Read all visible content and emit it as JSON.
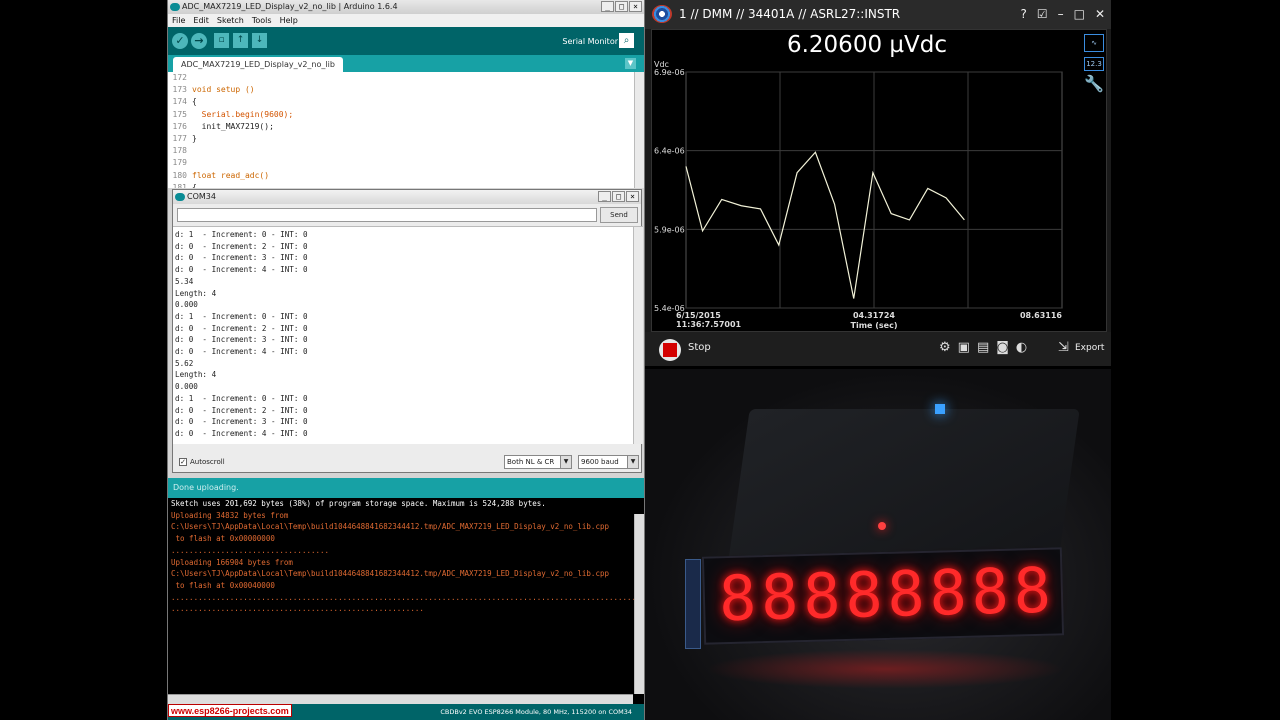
{
  "arduino": {
    "title": "ADC_MAX7219_LED_Display_v2_no_lib | Arduino 1.6.4",
    "menu": [
      "File",
      "Edit",
      "Sketch",
      "Tools",
      "Help"
    ],
    "serial_monitor_label": "Serial Monitor",
    "tab_label": "ADC_MAX7219_LED_Display_v2_no_lib",
    "code_lines": [
      {
        "n": "172",
        "code": ""
      },
      {
        "n": "173",
        "code": "void setup ()"
      },
      {
        "n": "174",
        "code": "{"
      },
      {
        "n": "175",
        "code": "  Serial.begin(9600);"
      },
      {
        "n": "176",
        "code": "  init_MAX7219();"
      },
      {
        "n": "177",
        "code": "}"
      },
      {
        "n": "178",
        "code": ""
      },
      {
        "n": "179",
        "code": ""
      },
      {
        "n": "180",
        "code": "float read_adc()"
      },
      {
        "n": "181",
        "code": "{"
      }
    ],
    "status": "Done uploading.",
    "console_lines": [
      {
        "text": "",
        "color": "white"
      },
      {
        "text": "Sketch uses 201,692 bytes (38%) of program storage space. Maximum is 524,288 bytes.",
        "color": "white"
      },
      {
        "text": "Uploading 34832 bytes from",
        "color": "orange"
      },
      {
        "text": "C:\\Users\\TJ\\AppData\\Local\\Temp\\build1044648841682344412.tmp/ADC_MAX7219_LED_Display_v2_no_lib.cpp",
        "color": "orange"
      },
      {
        "text": " to flash at 0x00000000",
        "color": "orange"
      },
      {
        "text": "",
        "color": "orange"
      },
      {
        "text": "...................................",
        "color": "orange"
      },
      {
        "text": "",
        "color": "orange"
      },
      {
        "text": "Uploading 166904 bytes from",
        "color": "orange"
      },
      {
        "text": "C:\\Users\\TJ\\AppData\\Local\\Temp\\build1044648841682344412.tmp/ADC_MAX7219_LED_Display_v2_no_lib.cpp",
        "color": "orange"
      },
      {
        "text": " to flash at 0x00040000",
        "color": "orange"
      },
      {
        "text": "",
        "color": "orange"
      },
      {
        "text": "...........................................................................................................................",
        "color": "orange"
      },
      {
        "text": "........................................................",
        "color": "orange"
      }
    ],
    "footer_message": "CBDBv2 EVO ESP8266 Module, 80 MHz, 115200 on COM34",
    "watermark": "www.esp8266-projects.com"
  },
  "com": {
    "title": "COM34",
    "send_label": "Send",
    "lines": [
      "d: 1  - Increment: 0 - INT: 0",
      "d: 0  - Increment: 2 - INT: 0",
      "d: 0  - Increment: 3 - INT: 0",
      "d: 0  - Increment: 4 - INT: 0",
      "5.34",
      "Length: 4",
      "0.000",
      "d: 1  - Increment: 0 - INT: 0",
      "d: 0  - Increment: 2 - INT: 0",
      "d: 0  - Increment: 3 - INT: 0",
      "d: 0  - Increment: 4 - INT: 0",
      "5.62",
      "Length: 4",
      "0.000",
      "d: 1  - Increment: 0 - INT: 0",
      "d: 0  - Increment: 2 - INT: 0",
      "d: 0  - Increment: 3 - INT: 0",
      "d: 0  - Increment: 4 - INT: 0"
    ],
    "autoscroll_label": "Autoscroll",
    "line_ending": "Both NL & CR",
    "baud": "9600 baud"
  },
  "dmm": {
    "title": "1 // DMM // 34401A // ASRL27::INSTR",
    "reading": "6.20600 µVdc",
    "side_value_icon": "12.3",
    "stop_label": "Stop",
    "export_label": "Export",
    "colors": {
      "plot_line": "#f2f2d8",
      "grid": "#3c3c3c",
      "stop": "#d40000"
    }
  },
  "chart_data": {
    "type": "line",
    "ylabel": "Vdc",
    "xlabel": "Time (sec)",
    "y_ticks": [
      "6.9e-06",
      "6.4e-06",
      "5.9e-06",
      "5.4e-06"
    ],
    "y_tick_values": [
      6.9e-06,
      6.4e-06,
      5.9e-06,
      5.4e-06
    ],
    "x_tick_labels": [
      "6/15/2015",
      "04.31724",
      "08.63116"
    ],
    "x_start_time": "11:36:7.57001",
    "ylim": [
      5.4e-06,
      6.9e-06
    ],
    "xlim": [
      0,
      8.63116
    ],
    "grid": true,
    "series": [
      {
        "x": [
          0,
          0.38,
          0.82,
          1.27,
          1.71,
          2.13,
          2.55,
          2.97,
          3.41,
          3.85,
          4.29,
          4.71,
          5.13,
          5.55,
          5.97,
          6.39
        ],
        "y": [
          6.3e-06,
          5.89e-06,
          6.09e-06,
          6.05e-06,
          6.03e-06,
          5.8e-06,
          6.26e-06,
          6.39e-06,
          6.06e-06,
          5.46e-06,
          6.26e-06,
          6e-06,
          5.96e-06,
          6.16e-06,
          6.1e-06,
          5.96e-06
        ]
      }
    ]
  },
  "photo": {
    "display_digits": [
      "8",
      "8",
      "8",
      "8",
      "8",
      "8",
      "8",
      "8"
    ]
  }
}
